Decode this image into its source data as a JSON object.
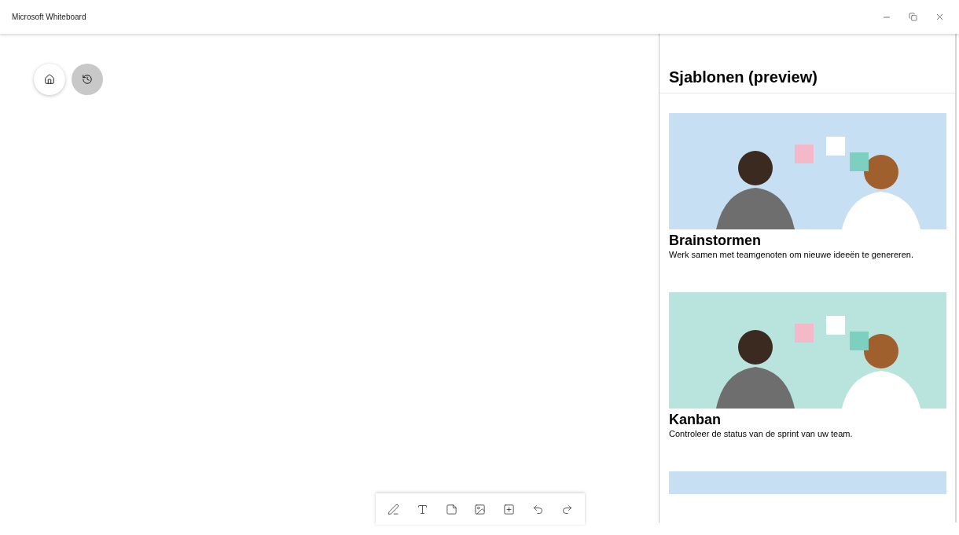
{
  "window": {
    "title": "Microsoft Whiteboard"
  },
  "panel": {
    "title": "Sjablonen (preview)",
    "templates": [
      {
        "title": "Brainstormen",
        "description": "Werk samen met teamgenoten om nieuwe ideeën te genereren.",
        "color": "#c7dff3"
      },
      {
        "title": "Kanban",
        "description": "Controleer de status van de sprint van uw team.",
        "color": "#b9e3dd"
      },
      {
        "color": "#c7dff3"
      }
    ]
  }
}
